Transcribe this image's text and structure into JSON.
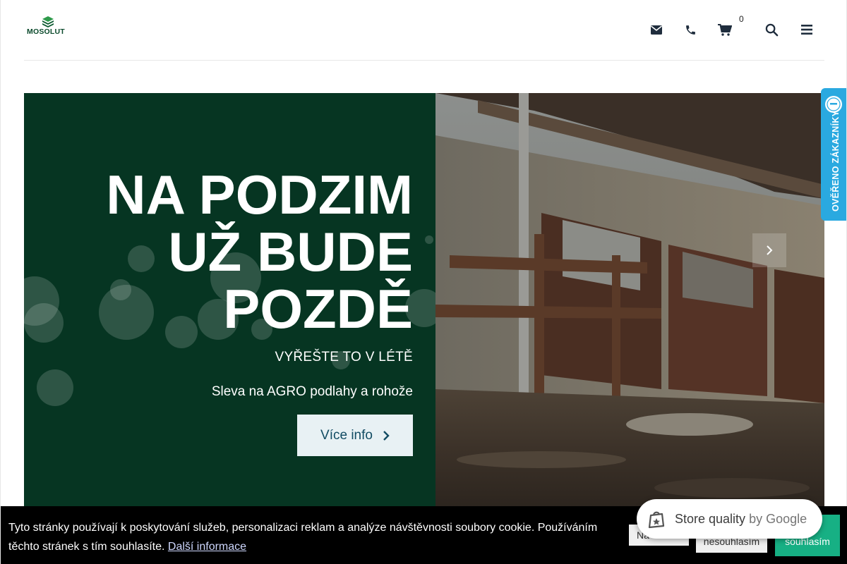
{
  "header": {
    "logo_text": "MOSOLUT",
    "cart_count": "0",
    "icons": [
      "envelope-icon",
      "phone-icon",
      "cart-icon",
      "search-icon",
      "menu-icon"
    ]
  },
  "hero": {
    "title_lines": [
      "NA PODZIM",
      "UŽ BUDE",
      "POZDĚ"
    ],
    "subtitle": "VYŘEŠTE TO V LÉTĚ",
    "description": "Sleva na AGRO podlahy a rohože",
    "button_label": "Více info"
  },
  "side_badge": {
    "label": "OVĚŘENO ZÁKAZNÍKY"
  },
  "cookie": {
    "text": "Tyto stránky používají k poskytování služeb, personalizaci reklam a analýze návštěvnosti soubory cookie. Používáním těchto stránek s tím souhlasíte.",
    "link": "Další informace",
    "settings_label": "Na",
    "disagree_label": "nesouhlasím",
    "agree_label": "souhlasím"
  },
  "store_quality": {
    "label": "Store quality",
    "by": "by Google"
  },
  "colors": {
    "brand_green": "#063522",
    "button_bg": "#e8f1f4",
    "button_text": "#124c63",
    "badge_blue": "#2aa9e0",
    "agree_green": "#17b084"
  }
}
